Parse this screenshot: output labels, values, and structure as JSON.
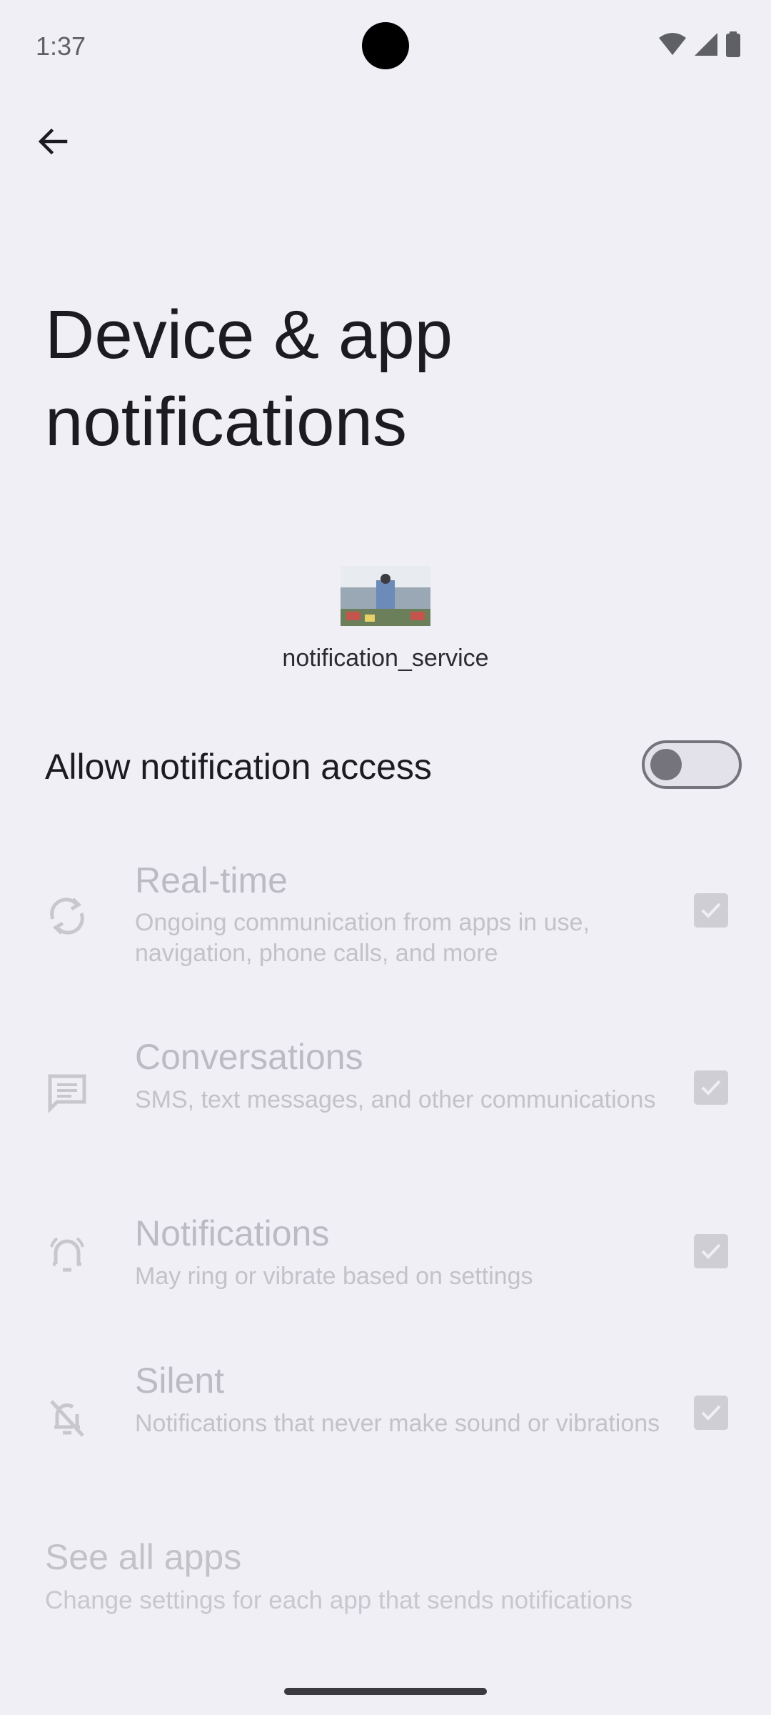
{
  "status_bar": {
    "time": "1:37",
    "icons": [
      "wifi-icon",
      "signal-icon",
      "battery-icon"
    ]
  },
  "nav": {
    "back_icon": "arrow-back-icon"
  },
  "page": {
    "title": "Device & app notifications"
  },
  "app": {
    "name": "notification_service",
    "icon": "app-thumbnail-image"
  },
  "allow_access": {
    "label": "Allow notification access",
    "enabled": false
  },
  "notification_types": [
    {
      "title": "Real-time",
      "description": "Ongoing communication from apps in use, navigation, phone calls, and more",
      "icon": "sync-icon",
      "checked": true
    },
    {
      "title": "Conversations",
      "description": "SMS, text messages, and other communications",
      "icon": "chat-icon",
      "checked": true
    },
    {
      "title": "Notifications",
      "description": "May ring or vibrate based on settings",
      "icon": "bell-ringing-icon",
      "checked": true
    },
    {
      "title": "Silent",
      "description": "Notifications that never make sound or vibrations",
      "icon": "bell-off-icon",
      "checked": true
    }
  ],
  "see_all": {
    "title": "See all apps",
    "description": "Change settings for each app that sends notifications"
  },
  "colors": {
    "background": "#f0eff5",
    "disabled_text": "#bcbac2",
    "toggle_off": "#75747c"
  }
}
